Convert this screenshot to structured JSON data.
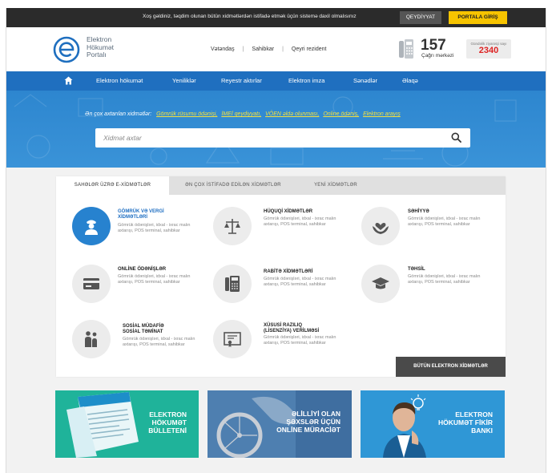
{
  "topbar": {
    "message": "Xoş gəldiniz, təqdim olunan bütün xidmətlərdən istifadə etmək üçün sistemə daxil olmalısınız",
    "register_label": "QEYDİYYAT",
    "login_label": "PORTALA GİRİŞ"
  },
  "header": {
    "logo_line1": "Elektron",
    "logo_line2": "Hökumət",
    "logo_line3": "Portalı",
    "nav": [
      "Vətəndaş",
      "Sahibkar",
      "Qeyri rezident"
    ],
    "call_number": "157",
    "call_caption": "Çağrı mərkəzi",
    "visitors_caption": "Gündəlik ziyarətçi sayı",
    "visitors_count": "2340"
  },
  "mainnav": {
    "items": [
      "Elektron hökumət",
      "Yeniliklər",
      "Reyestr aktırlar",
      "Elektron imza",
      "Sənədlər",
      "Əlaqə"
    ]
  },
  "hero": {
    "popular_label": "Ən çox axtarılan xidmətlər:",
    "popular_links": [
      "Gömrük rüsumu ödənişi,",
      "İMEİ qeydiyyatı,",
      "VÖEN əldə olunması,",
      "Online ödəniş,",
      "Elektron arayış"
    ],
    "search_placeholder": "Xidmət axtar"
  },
  "tabs": [
    "SAHƏLƏR ÜZRƏ E-XİDMƏTLƏR",
    "ƏN ÇOX İSTİFADƏ EDİLƏN XİDMƏTLƏR",
    "YENİ XİDMƏTLƏR"
  ],
  "services": [
    {
      "title1": "GÖMRÜK VƏ VERGİ",
      "title2": "XİDMƏTLƏRİ",
      "desc": "Gömrük ödənişləri, idxal - ixrac malın axtarışı, POS terminal, sahibkar",
      "icon": "customs-officer-icon"
    },
    {
      "title1": "HÜQUQİ XİDMƏTLƏR",
      "title2": "",
      "desc": "Gömrük ödənişləri, idxal - ixrac malın axtarışı, POS terminal, sahibkar",
      "icon": "scales-icon"
    },
    {
      "title1": "SƏHİYYƏ",
      "title2": "",
      "desc": "Gömrük ödənişləri, idxal - ixrac malın axtarışı, POS terminal, sahibkar",
      "icon": "heart-hands-icon"
    },
    {
      "title1": "ONLİNE ÖDƏNİŞLƏR",
      "title2": "",
      "desc": "Gömrük ödənişləri, idxal - ixrac malın axtarışı, POS terminal, sahibkar",
      "icon": "card-icon"
    },
    {
      "title1": "RABİTƏ XİDMƏTLƏRİ",
      "title2": "",
      "desc": "Gömrük ödənişləri, idxal - ixrac malın axtarışı, POS terminal, sahibkar",
      "icon": "phone-icon"
    },
    {
      "title1": "TƏHSİL",
      "title2": "",
      "desc": "Gömrük ödənişləri, idxal - ixrac malın axtarışı, POS terminal, sahibkar",
      "icon": "graduation-cap-icon"
    },
    {
      "title1": "SOSİAL MÜDAFİƏ",
      "title2": "SOSİAL TƏMİNAT",
      "desc": "Gömrük ödənişləri, idxal - ixrac malın axtarışı, POS terminal, sahibkar",
      "icon": "family-icon"
    },
    {
      "title1": "XÜSUSİ RAZILIQ",
      "title2": "(LİSENZİYA) VERİLMƏSİ",
      "desc": "Gömrük ödənişləri, idxal - ixrac malın axtarışı, POS terminal, sahibkar",
      "icon": "certificate-icon"
    }
  ],
  "all_services_label": "BÜTÜN ELEKTRON XİDMƏTLƏR",
  "banners": [
    {
      "line1": "ELEKTRON",
      "line2": "HÖKUMƏT",
      "line3": "BÜLLETENİ"
    },
    {
      "line1": "ƏLİLLİYİ OLAN",
      "line2": "ŞƏXSLƏR ÜÇÜN",
      "line3": "ONLİNE MÜRACİƏT"
    },
    {
      "line1": "ELEKTRON",
      "line2": "HÖKUMƏT FİKİR",
      "line3": "BANKI"
    }
  ],
  "colors": {
    "nav_blue": "#1f6fbf",
    "hero_blue": "#3a93d8",
    "accent_yellow": "#f7c400",
    "link_yellow": "#f6e13c",
    "active_circle": "#2782cf"
  }
}
